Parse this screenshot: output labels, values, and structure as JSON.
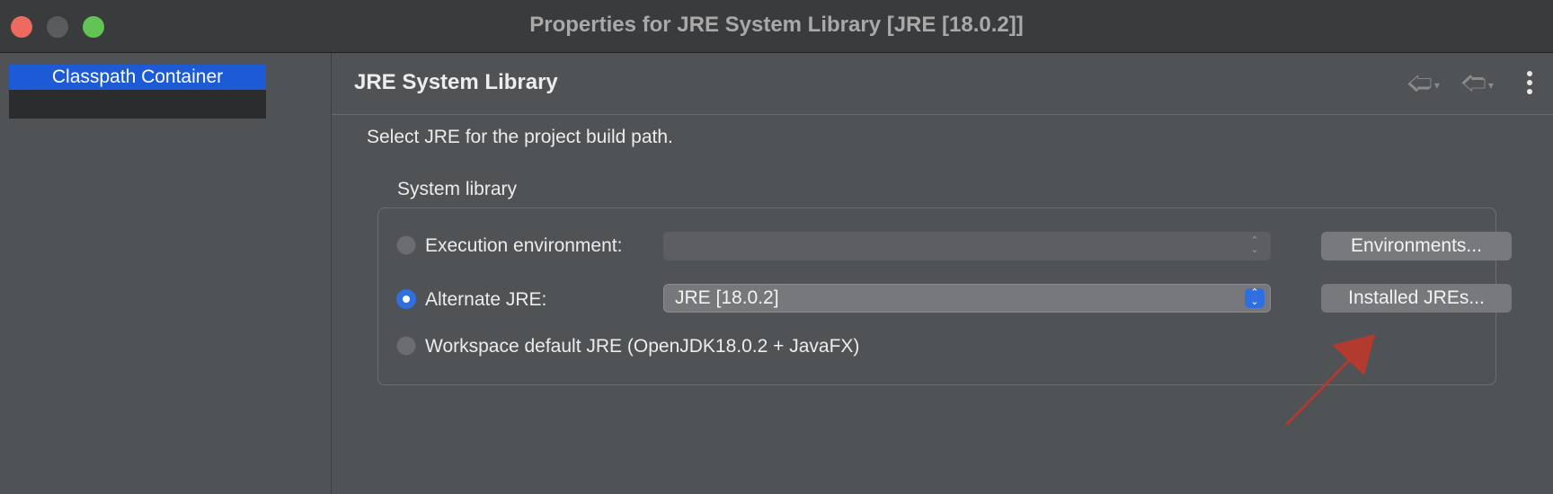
{
  "window": {
    "title": "Properties for JRE System Library [JRE [18.0.2]]"
  },
  "sidebar": {
    "items": [
      {
        "label": "Classpath Container",
        "selected": true
      }
    ]
  },
  "page": {
    "title": "JRE System Library",
    "description": "Select JRE for the project build path.",
    "group_label": "System library"
  },
  "options": {
    "execution_environment": {
      "label": "Execution environment:",
      "selected": false,
      "value": "",
      "button_label": "Environments..."
    },
    "alternate_jre": {
      "label": "Alternate JRE:",
      "selected": true,
      "value": "JRE [18.0.2]",
      "button_label": "Installed JREs..."
    },
    "workspace_default": {
      "label": "Workspace default JRE (OpenJDK18.0.2 + JavaFX)",
      "selected": false
    }
  },
  "icons": {
    "back": "arrow-left-icon",
    "forward": "arrow-right-icon",
    "menu": "kebab-menu-icon",
    "stepper": "up-down-chevron-icon"
  },
  "colors": {
    "accent": "#2f6fe0",
    "selection": "#1d5bd6",
    "annotation_arrow": "#b23a2e"
  }
}
